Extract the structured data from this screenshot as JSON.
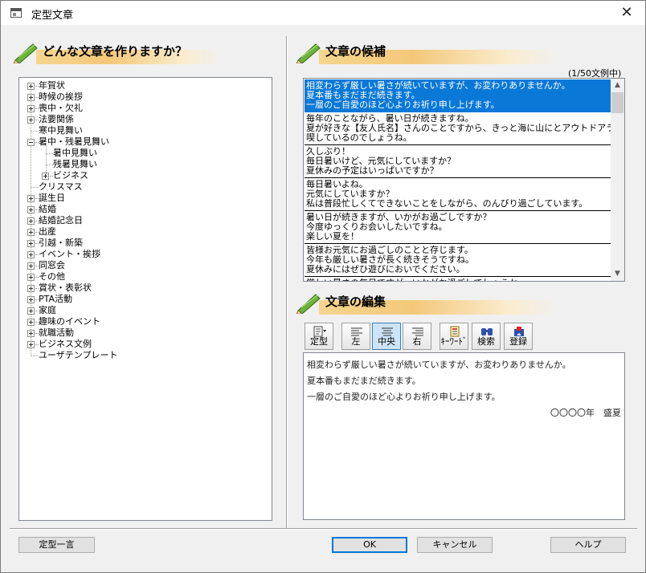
{
  "window": {
    "title": "定型文章"
  },
  "left_header": "どんな文章を作りますか？",
  "right_header_candidates": "文章の候補",
  "right_header_edit": "文章の編集",
  "count_label": "(1/50文例中)",
  "tree": [
    {
      "label": "年賀状",
      "expander": "plus",
      "level": 0
    },
    {
      "label": "時候の挨拶",
      "expander": "plus",
      "level": 0
    },
    {
      "label": "喪中・欠礼",
      "expander": "plus",
      "level": 0
    },
    {
      "label": "法要関係",
      "expander": "plus",
      "level": 0
    },
    {
      "label": "寒中見舞い",
      "expander": "none",
      "level": 0
    },
    {
      "label": "暑中・残暑見舞い",
      "expander": "minus",
      "level": 0
    },
    {
      "label": "暑中見舞い",
      "expander": "none",
      "level": 1
    },
    {
      "label": "残暑見舞い",
      "expander": "none",
      "level": 1
    },
    {
      "label": "ビジネス",
      "expander": "plus",
      "level": 1
    },
    {
      "label": "クリスマス",
      "expander": "none",
      "level": 0
    },
    {
      "label": "誕生日",
      "expander": "plus",
      "level": 0
    },
    {
      "label": "結婚",
      "expander": "plus",
      "level": 0
    },
    {
      "label": "結婚記念日",
      "expander": "plus",
      "level": 0
    },
    {
      "label": "出産",
      "expander": "plus",
      "level": 0
    },
    {
      "label": "引越・新築",
      "expander": "plus",
      "level": 0
    },
    {
      "label": "イベント・挨拶",
      "expander": "plus",
      "level": 0
    },
    {
      "label": "同窓会",
      "expander": "plus",
      "level": 0
    },
    {
      "label": "その他",
      "expander": "plus",
      "level": 0
    },
    {
      "label": "賞状・表彰状",
      "expander": "plus",
      "level": 0
    },
    {
      "label": "PTA活動",
      "expander": "plus",
      "level": 0
    },
    {
      "label": "家庭",
      "expander": "plus",
      "level": 0
    },
    {
      "label": "趣味のイベント",
      "expander": "plus",
      "level": 0
    },
    {
      "label": "就職活動",
      "expander": "plus",
      "level": 0
    },
    {
      "label": "ビジネス文例",
      "expander": "plus",
      "level": 0
    },
    {
      "label": "ユーザテンプレート",
      "expander": "none",
      "level": 0
    }
  ],
  "candidates": [
    {
      "selected": true,
      "lines": [
        "相変わらず厳しい暑さが続いていますが、お変わりありませんか。",
        "夏本番もまだまだ続きます。",
        "一層のご自愛のほど心よりお祈り申し上げます。"
      ]
    },
    {
      "selected": false,
      "lines": [
        "毎年のことながら、暑い日が続きますね。",
        "夏が好きな【友人氏名】さんのことですから、きっと海に山にとアウトドアライフを満",
        "喫しているのでしょうね。"
      ]
    },
    {
      "selected": false,
      "lines": [
        "久しぶり！",
        "毎日暑いけど、元気にしていますか？",
        "夏休みの予定はいっぱいですか？"
      ]
    },
    {
      "selected": false,
      "lines": [
        "毎日暑いよね。",
        "元気にしていますか？",
        "私は普段忙しくてできないことをしながら、のんびり過ごしています。"
      ]
    },
    {
      "selected": false,
      "lines": [
        "暑い日が続きますが、いかがお過ごしですか？",
        "今度ゆっくりお会いしたいですね。",
        "楽しい夏を！"
      ]
    },
    {
      "selected": false,
      "lines": [
        "皆様お元気にお過ごしのことと存じます。",
        "今年も厳しい暑さが長く続きそうですね。",
        "夏休みにはぜひ遊びにおいでください。"
      ]
    },
    {
      "selected": false,
      "lines": [
        "厳しい暑さの毎日ですが、いかがお過ごしでしょうか。"
      ]
    }
  ],
  "toolbar": {
    "template": "定型",
    "left": "左",
    "center": "中央",
    "right": "右",
    "keyword": "ｷｰﾜｰﾄﾞ",
    "search": "検索",
    "register": "登録"
  },
  "editor": {
    "lines": [
      "相変わらず厳しい暑さが続いていますが、お変わりありませんか。",
      "夏本番もまだまだ続きます。",
      "一層のご自愛のほど心よりお祈り申し上げます。"
    ],
    "signature": "〇〇〇〇年　盛夏"
  },
  "buttons": {
    "teikei_ichigen": "定型一言",
    "ok": "OK",
    "cancel": "キャンセル",
    "help": "ヘルプ"
  },
  "colors": {
    "selection": "#0a78d7",
    "header_bar": "#f3c87a",
    "pencil_green": "#5a9e2f"
  }
}
